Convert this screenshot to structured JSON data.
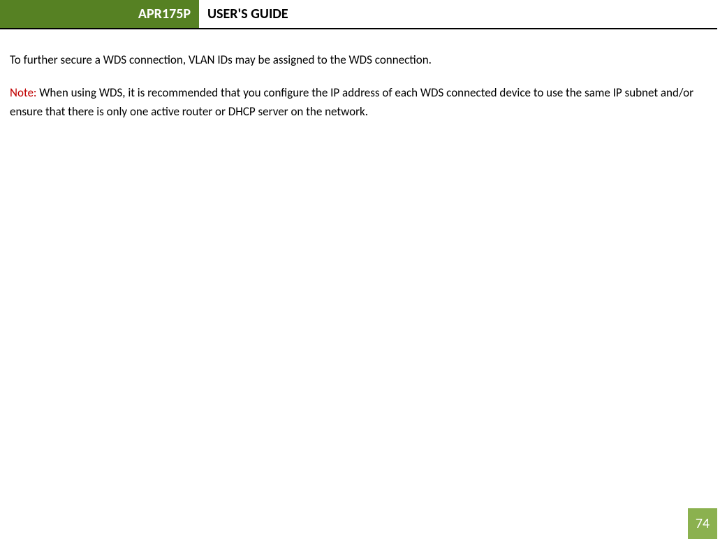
{
  "header": {
    "model": "APR175P",
    "title": "USER'S GUIDE"
  },
  "content": {
    "para1": "To further secure a WDS connection, VLAN IDs may be assigned to the WDS connection.",
    "note_label": "Note:",
    "note_text": " When using WDS, it is recommended that you configure the IP address of each WDS connected device to use the same IP subnet and/or ensure that there is only one active router or DHCP server on the network."
  },
  "page_number": "74"
}
